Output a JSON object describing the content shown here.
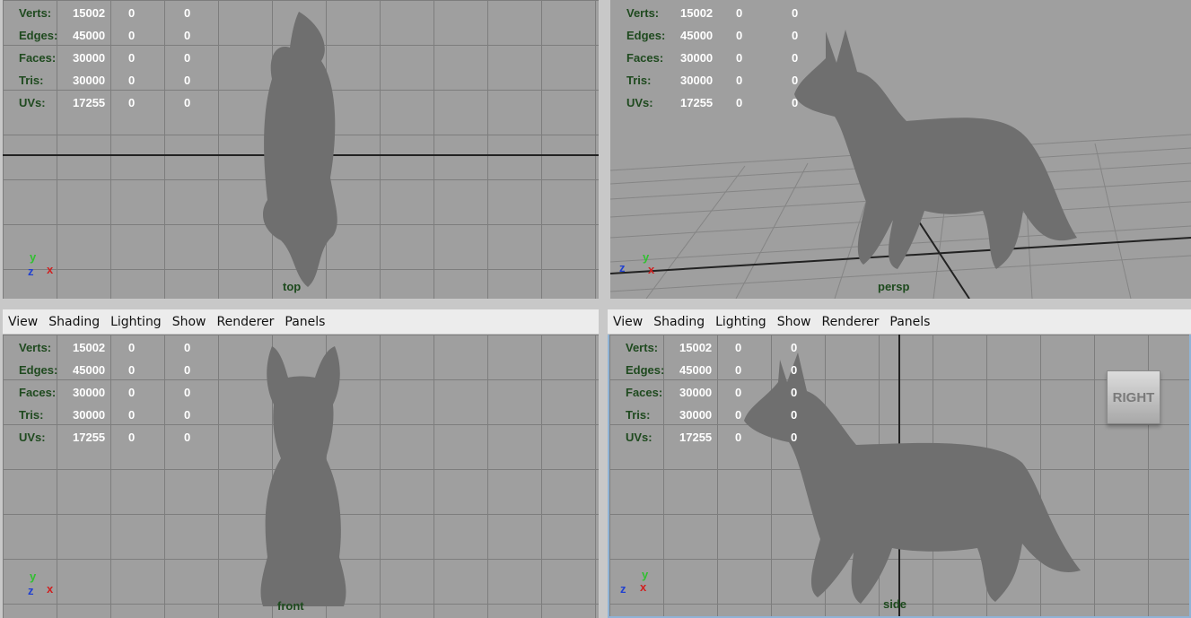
{
  "menu": [
    "View",
    "Shading",
    "Lighting",
    "Show",
    "Renderer",
    "Panels"
  ],
  "hud": [
    {
      "label": "Verts:",
      "v1": "15002",
      "v2": "0",
      "v3": "0"
    },
    {
      "label": "Edges:",
      "v1": "45000",
      "v2": "0",
      "v3": "0"
    },
    {
      "label": "Faces:",
      "v1": "30000",
      "v2": "0",
      "v3": "0"
    },
    {
      "label": "Tris:",
      "v1": "30000",
      "v2": "0",
      "v3": "0"
    },
    {
      "label": "UVs:",
      "v1": "17255",
      "v2": "0",
      "v3": "0"
    }
  ],
  "panels": {
    "top": {
      "camera": "top"
    },
    "persp": {
      "camera": "persp"
    },
    "front": {
      "camera": "front"
    },
    "side": {
      "camera": "side"
    }
  },
  "axis": {
    "x": "x",
    "y": "y",
    "z": "z"
  },
  "view_cube": {
    "label": "RIGHT"
  }
}
